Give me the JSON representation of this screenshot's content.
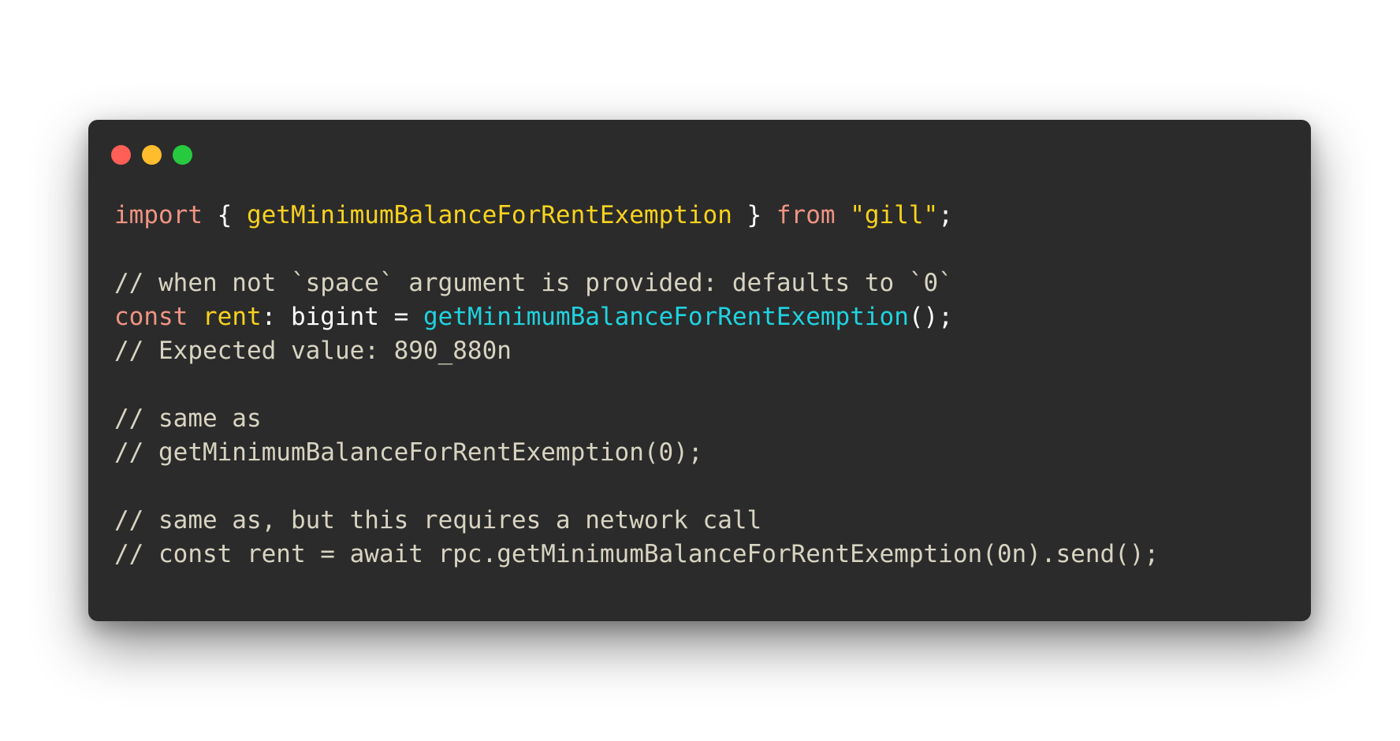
{
  "window": {
    "controls": [
      {
        "name": "close",
        "color": "#ff5f56"
      },
      {
        "name": "minimize",
        "color": "#ffbd2e"
      },
      {
        "name": "zoom",
        "color": "#27c93f"
      }
    ]
  },
  "colors": {
    "background": "#2b2b2b",
    "keyword": "#f09483",
    "identifier": "#f8d21e",
    "function": "#1fd3e0",
    "comment": "#d8d4c2",
    "plain": "#ffffff"
  },
  "code": {
    "lines": [
      [
        {
          "type": "keyword",
          "text": "import"
        },
        {
          "type": "plain",
          "text": " { "
        },
        {
          "type": "ident",
          "text": "getMinimumBalanceForRentExemption"
        },
        {
          "type": "plain",
          "text": " } "
        },
        {
          "type": "keyword",
          "text": "from"
        },
        {
          "type": "plain",
          "text": " "
        },
        {
          "type": "string",
          "text": "\"gill\""
        },
        {
          "type": "plain",
          "text": ";"
        }
      ],
      [],
      [
        {
          "type": "comment",
          "text": "// when not `space` argument is provided: defaults to `0`"
        }
      ],
      [
        {
          "type": "keyword",
          "text": "const"
        },
        {
          "type": "plain",
          "text": " "
        },
        {
          "type": "ident",
          "text": "rent"
        },
        {
          "type": "plain",
          "text": ": bigint = "
        },
        {
          "type": "func",
          "text": "getMinimumBalanceForRentExemption"
        },
        {
          "type": "plain",
          "text": "();"
        }
      ],
      [
        {
          "type": "comment",
          "text": "// Expected value: 890_880n"
        }
      ],
      [],
      [
        {
          "type": "comment",
          "text": "// same as"
        }
      ],
      [
        {
          "type": "comment",
          "text": "// getMinimumBalanceForRentExemption(0);"
        }
      ],
      [],
      [
        {
          "type": "comment",
          "text": "// same as, but this requires a network call"
        }
      ],
      [
        {
          "type": "comment",
          "text": "// const rent = await rpc.getMinimumBalanceForRentExemption(0n).send();"
        }
      ]
    ]
  }
}
